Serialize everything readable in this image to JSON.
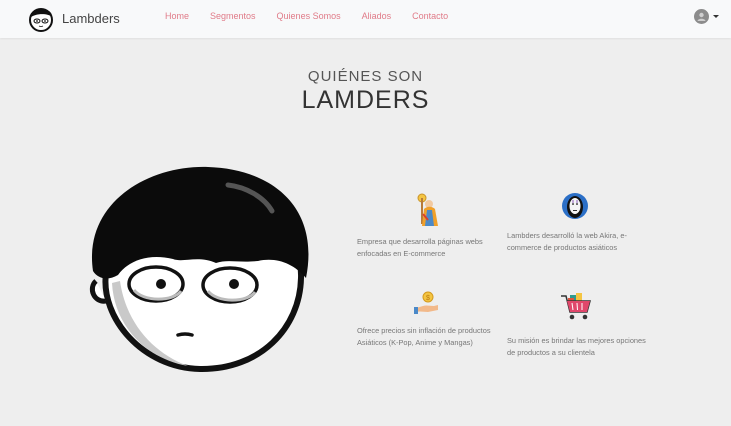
{
  "brand": {
    "name": "Lambders"
  },
  "nav": {
    "links": [
      "Home",
      "Segmentos",
      "Quienes Somos",
      "Aliados",
      "Contacto"
    ]
  },
  "user_menu": {
    "avatar_icon": "user-avatar-icon"
  },
  "section": {
    "subtitle": "QUIÉNES SON",
    "title": "LAMDERS"
  },
  "features": [
    {
      "icon": "monk-icon",
      "text": "Empresa que desarrolla páginas webs enfocadas en E-commerce"
    },
    {
      "icon": "noface-mask-icon",
      "text": "Lambders desarrolló la web Akira, e-commerce de productos asiáticos"
    },
    {
      "icon": "hand-coins-icon",
      "text": "Ofrece precios sin inflación de productos Asiáticos (K-Pop, Anime y Mangas)"
    },
    {
      "icon": "shopping-cart-icon",
      "text": "Su misión es brindar las mejores opciones de productos a su clientela"
    }
  ],
  "colors": {
    "nav_link": "#e07b88",
    "background": "#eeeeee",
    "navbar": "#f8f9fa"
  }
}
